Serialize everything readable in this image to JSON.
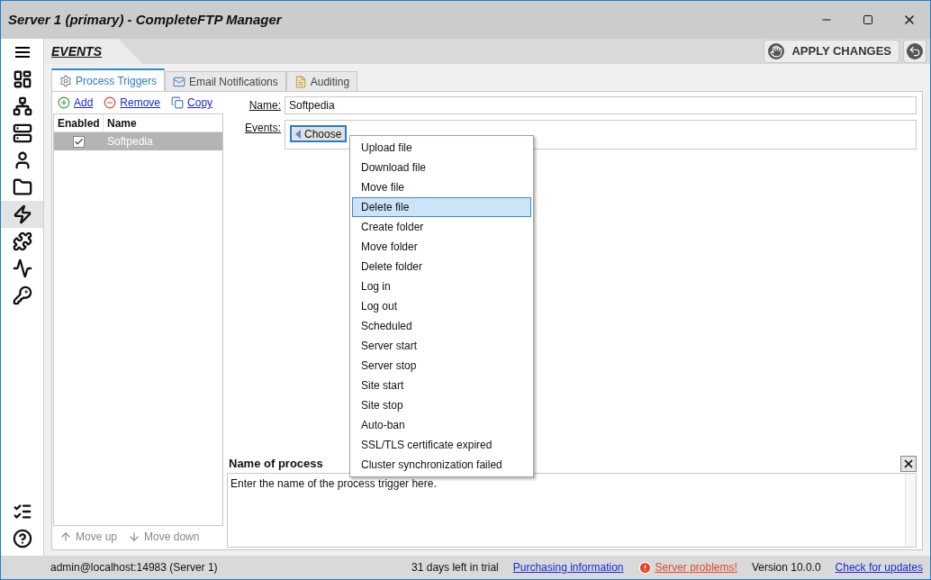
{
  "window": {
    "title": "Server 1 (primary) - CompleteFTP Manager"
  },
  "sidebar": {
    "items": [
      {
        "kind": "dashboard",
        "selected": false
      },
      {
        "kind": "cluster",
        "selected": false
      },
      {
        "kind": "servers",
        "selected": false
      },
      {
        "kind": "users",
        "selected": false
      },
      {
        "kind": "folders",
        "selected": false
      },
      {
        "kind": "events",
        "selected": true
      },
      {
        "kind": "extensions",
        "selected": false
      },
      {
        "kind": "monitoring",
        "selected": false
      },
      {
        "kind": "security",
        "selected": false
      }
    ],
    "bottom_items": [
      {
        "kind": "list"
      },
      {
        "kind": "help"
      }
    ]
  },
  "header": {
    "title": "EVENTS",
    "apply_button": "APPLY CHANGES"
  },
  "tabs": [
    {
      "label": "Process Triggers",
      "selected": true
    },
    {
      "label": "Email Notifications",
      "selected": false
    },
    {
      "label": "Auditing",
      "selected": false
    }
  ],
  "toolbar": [
    {
      "label": "Add"
    },
    {
      "label": "Remove"
    },
    {
      "label": "Copy"
    }
  ],
  "triggers": {
    "columns": [
      "Enabled",
      "Name"
    ],
    "rows": [
      {
        "name": "Softpedia",
        "enabled": true,
        "selected": true
      }
    ]
  },
  "move_buttons": [
    {
      "label": "Move up",
      "disabled": true
    },
    {
      "label": "Move down",
      "disabled": true
    }
  ],
  "form": {
    "name_label": "Name:",
    "name_value": "Softpedia",
    "events_label": "Events:",
    "choose_button": "Choose"
  },
  "events_menu": [
    {
      "label": "Upload file",
      "selected": false
    },
    {
      "label": "Download file",
      "selected": false
    },
    {
      "label": "Move file",
      "selected": false
    },
    {
      "label": "Delete file",
      "selected": true
    },
    {
      "label": "Create folder",
      "selected": false
    },
    {
      "label": "Move folder",
      "selected": false
    },
    {
      "label": "Delete folder",
      "selected": false
    },
    {
      "label": "Log in",
      "selected": false
    },
    {
      "label": "Log out",
      "selected": false
    },
    {
      "label": "Scheduled",
      "selected": false
    },
    {
      "label": "Server start",
      "selected": false
    },
    {
      "label": "Server stop",
      "selected": false
    },
    {
      "label": "Site start",
      "selected": false
    },
    {
      "label": "Site stop",
      "selected": false
    },
    {
      "label": "Auto-ban",
      "selected": false
    },
    {
      "label": "SSL/TLS certificate expired",
      "selected": false
    },
    {
      "label": "Cluster synchronization failed",
      "selected": false
    }
  ],
  "help_pane": {
    "title": "Name of process",
    "text": "Enter the name of the process trigger here."
  },
  "status_bar": {
    "connection": "admin@localhost:14983 (Server 1)",
    "trial": "31 days left in trial",
    "purchasing_link": "Purchasing information",
    "problems_link": "Server problems!",
    "version": "Version 10.0.0",
    "updates_link": "Check for updates"
  }
}
